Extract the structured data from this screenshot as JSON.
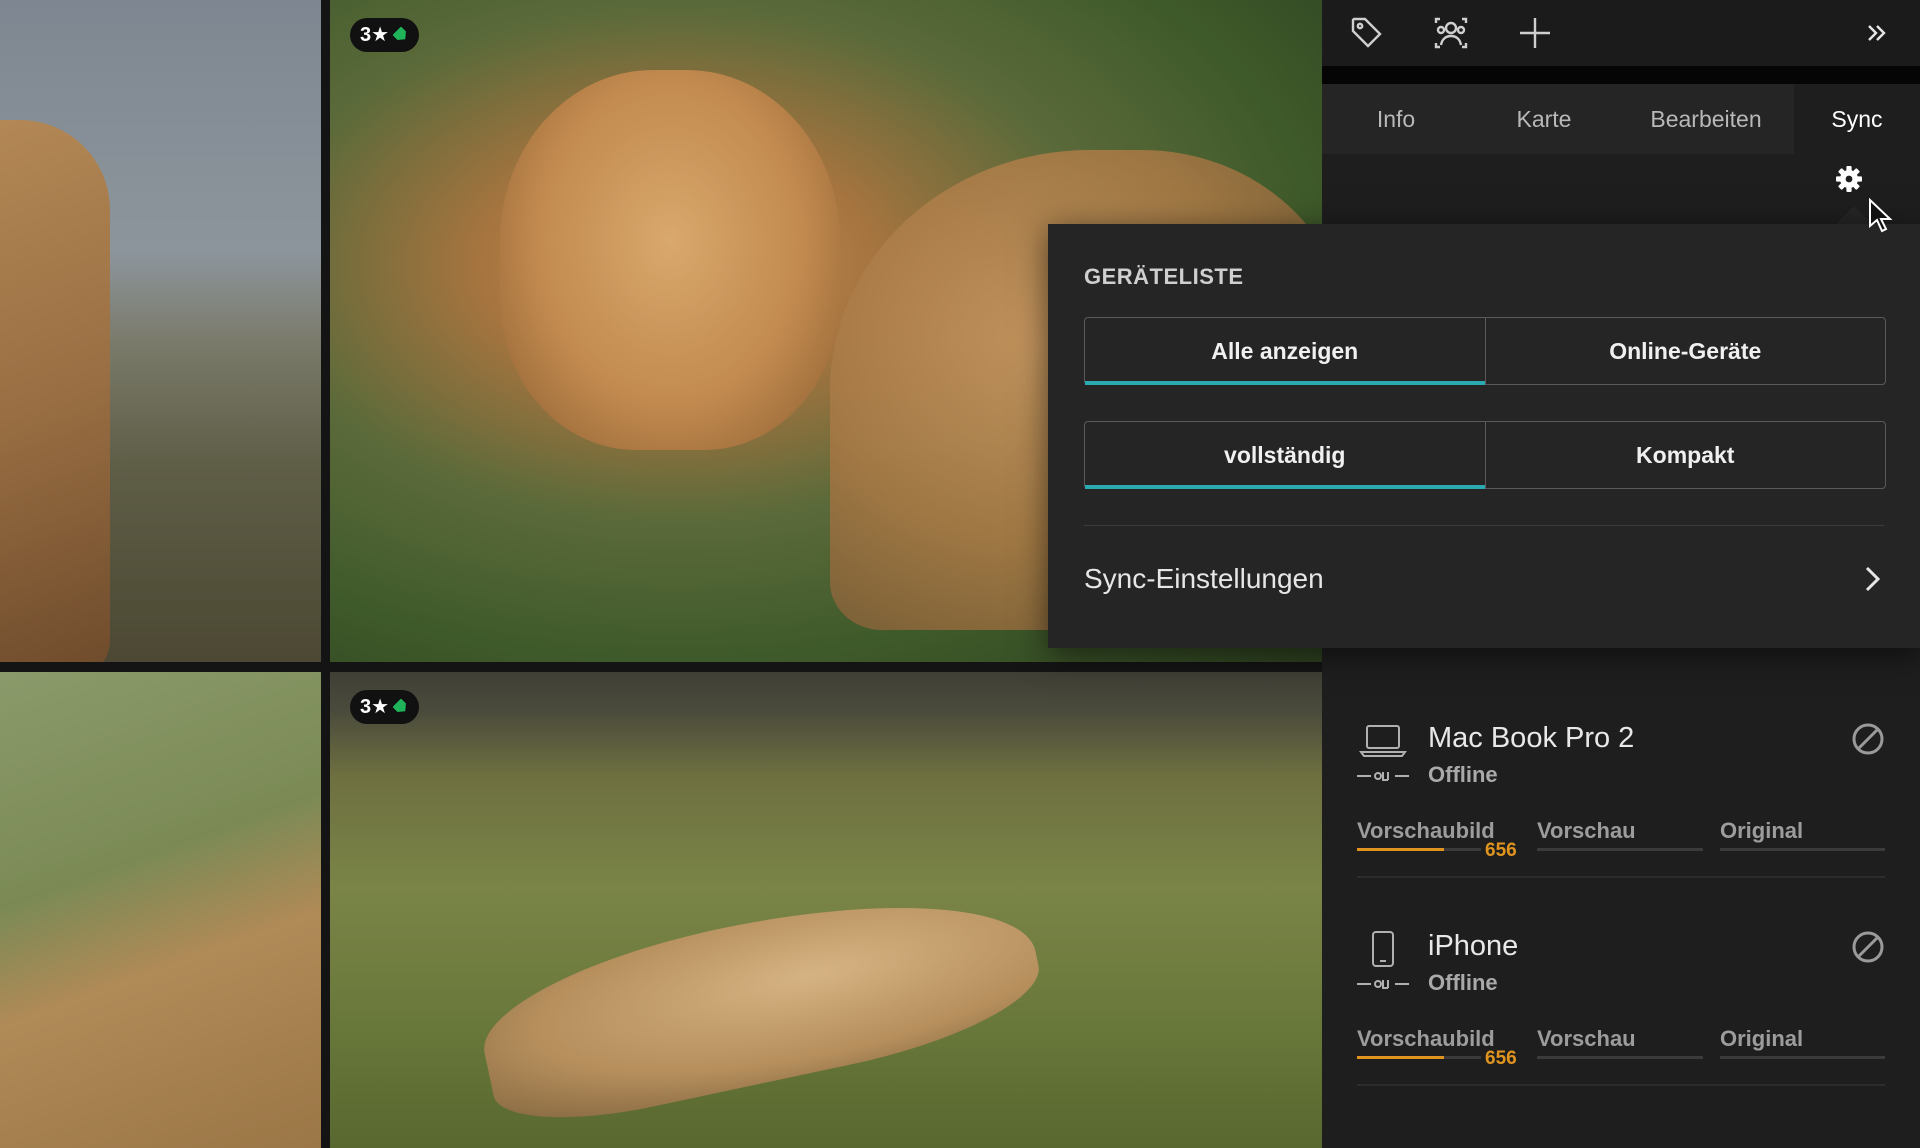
{
  "photos": [
    {
      "rating": "3★",
      "tag_color": "#1fb35a"
    },
    {
      "rating": "3★",
      "tag_color": "#1fb35a"
    }
  ],
  "toolbar": {
    "icons": [
      "tag-icon",
      "people-icon",
      "plus-icon",
      "double-chevron-right-icon"
    ]
  },
  "tabs": [
    {
      "label": "Info",
      "active": false
    },
    {
      "label": "Karte",
      "active": false
    },
    {
      "label": "Bearbeiten",
      "active": false
    },
    {
      "label": "Sync",
      "active": true
    }
  ],
  "popover": {
    "title": "GERÄTELISTE",
    "filter": {
      "options": [
        "Alle anzeigen",
        "Online-Geräte"
      ],
      "selected": "Alle anzeigen"
    },
    "view": {
      "options": [
        "vollständig",
        "Kompakt"
      ],
      "selected": "vollständig"
    },
    "sync_settings_label": "Sync-Einstellungen"
  },
  "devices": [
    {
      "name": "Mac Book Pro 2",
      "type": "laptop",
      "status": "Offline",
      "columns": [
        "Vorschaubild",
        "Vorschau",
        "Original"
      ],
      "thumbnail_count": "656",
      "thumbnail_progress": 0.7
    },
    {
      "name": "iPhone",
      "type": "phone",
      "status": "Offline",
      "columns": [
        "Vorschaubild",
        "Vorschau",
        "Original"
      ],
      "thumbnail_count": "656",
      "thumbnail_progress": 0.7
    }
  ],
  "colors": {
    "accent": "#2aa9b0",
    "progress": "#e0941f",
    "tag": "#1fb35a"
  }
}
